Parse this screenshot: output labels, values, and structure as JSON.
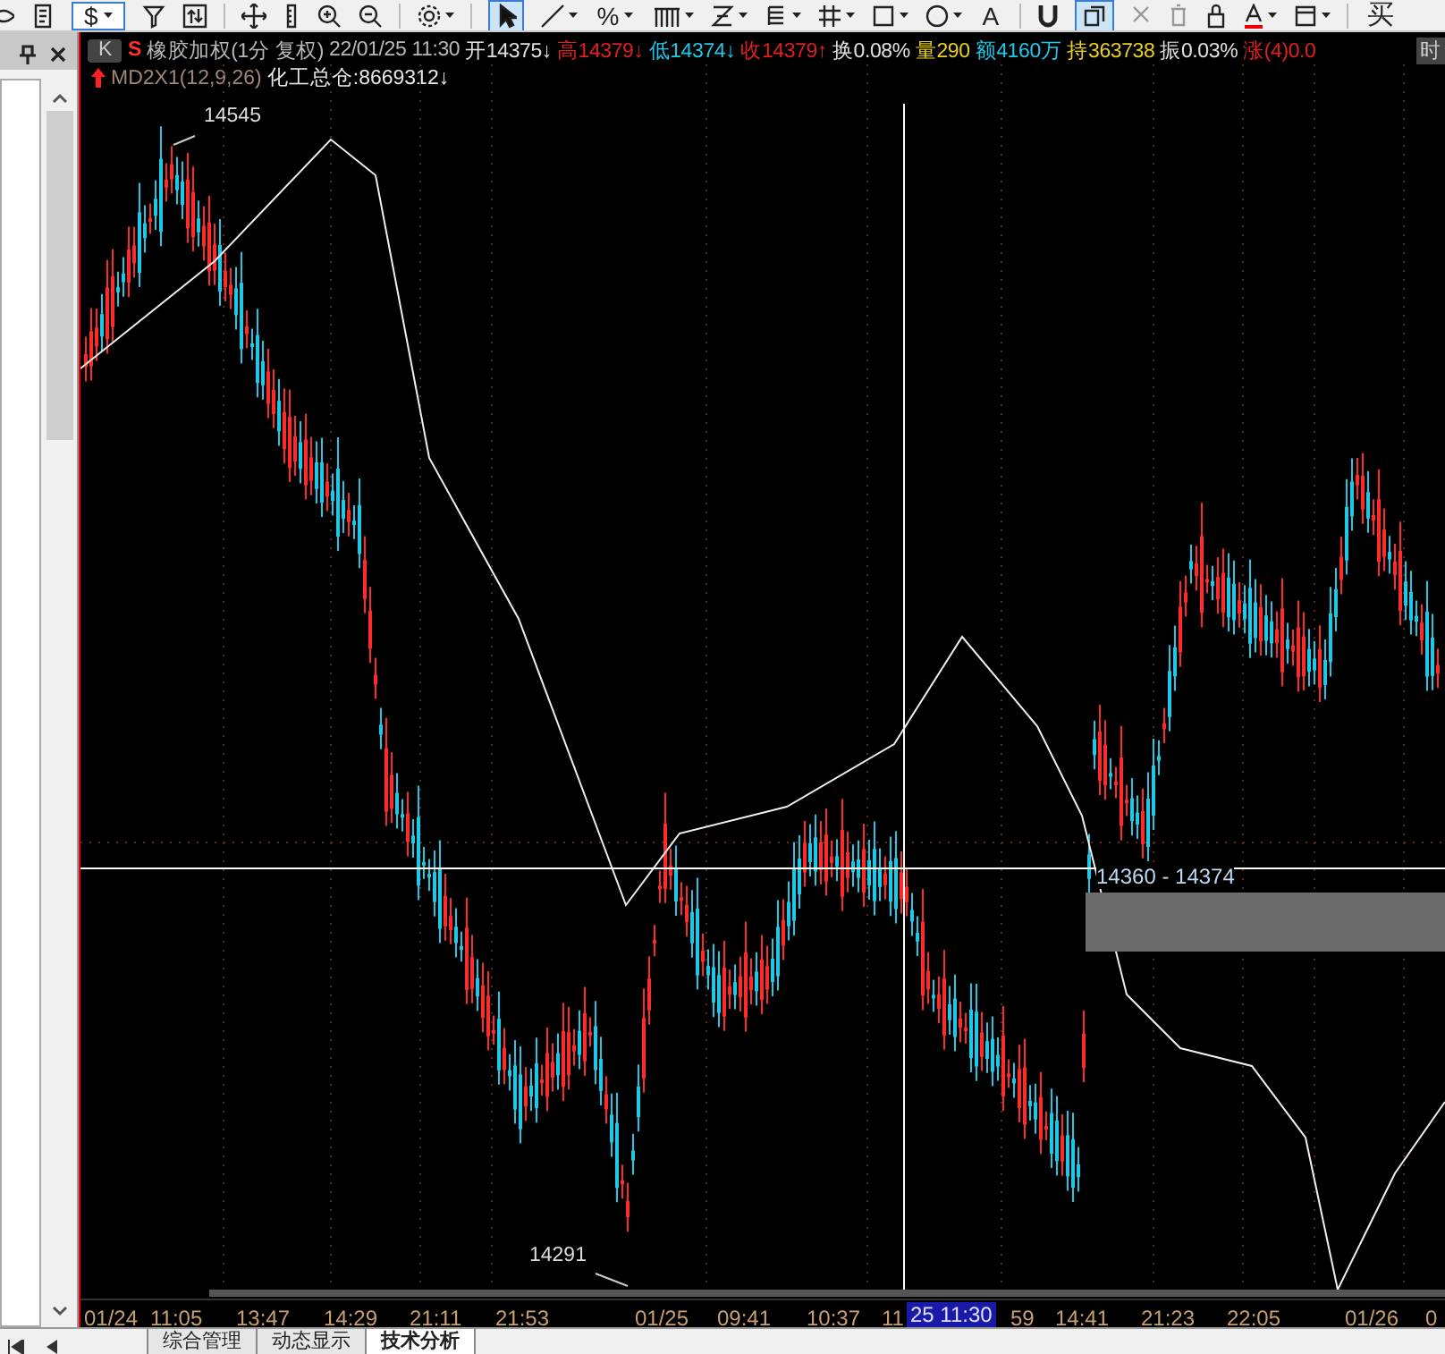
{
  "toolbar": {
    "dollar_button": "$",
    "percent_button": "%",
    "text_tool": "A",
    "buy_button": "买",
    "cursor_tool": {
      "selected": true
    }
  },
  "chart_header": {
    "badge": "K",
    "symbol_mark": "S",
    "title": "橡胶加权(1分 复权)",
    "datetime": "22/01/25 11:30",
    "quotes": [
      {
        "text": "开14375↓",
        "color": "#e0e0e0"
      },
      {
        "text": "高14379↓",
        "color": "#e02020"
      },
      {
        "text": "低14374↓",
        "color": "#20c8e8"
      },
      {
        "text": "收14379↑",
        "color": "#e02020"
      },
      {
        "text": "换0.08%",
        "color": "#e0e0e0"
      },
      {
        "text": "量290",
        "color": "#e8d020"
      },
      {
        "text": "额4160万",
        "color": "#20c8e8"
      },
      {
        "text": "持363738",
        "color": "#e8d020"
      },
      {
        "text": "振0.03%",
        "color": "#e0e0e0"
      },
      {
        "text": "涨(4)0.0",
        "color": "#e02020"
      }
    ],
    "period_badge": "时"
  },
  "indicator": {
    "name": "MD2X1(12,9,26)",
    "value": "化工总仓:8669312↓"
  },
  "chart": {
    "high_label": "14545",
    "low_label": "14291",
    "range_label": "14360 - 14374"
  },
  "x_axis": {
    "labels": [
      "01/24",
      "11:05",
      "13:47",
      "14:29",
      "21:11",
      "21:53",
      "01/25",
      "09:41",
      "10:37",
      "11",
      "59",
      "14:41",
      "21:23",
      "22:05",
      "01/26",
      "0"
    ],
    "cursor_label": "25 11:30"
  },
  "tabs": [
    {
      "label": "综合管理",
      "selected": false
    },
    {
      "label": "动态显示",
      "selected": false
    },
    {
      "label": "技术分析",
      "selected": true
    }
  ]
}
